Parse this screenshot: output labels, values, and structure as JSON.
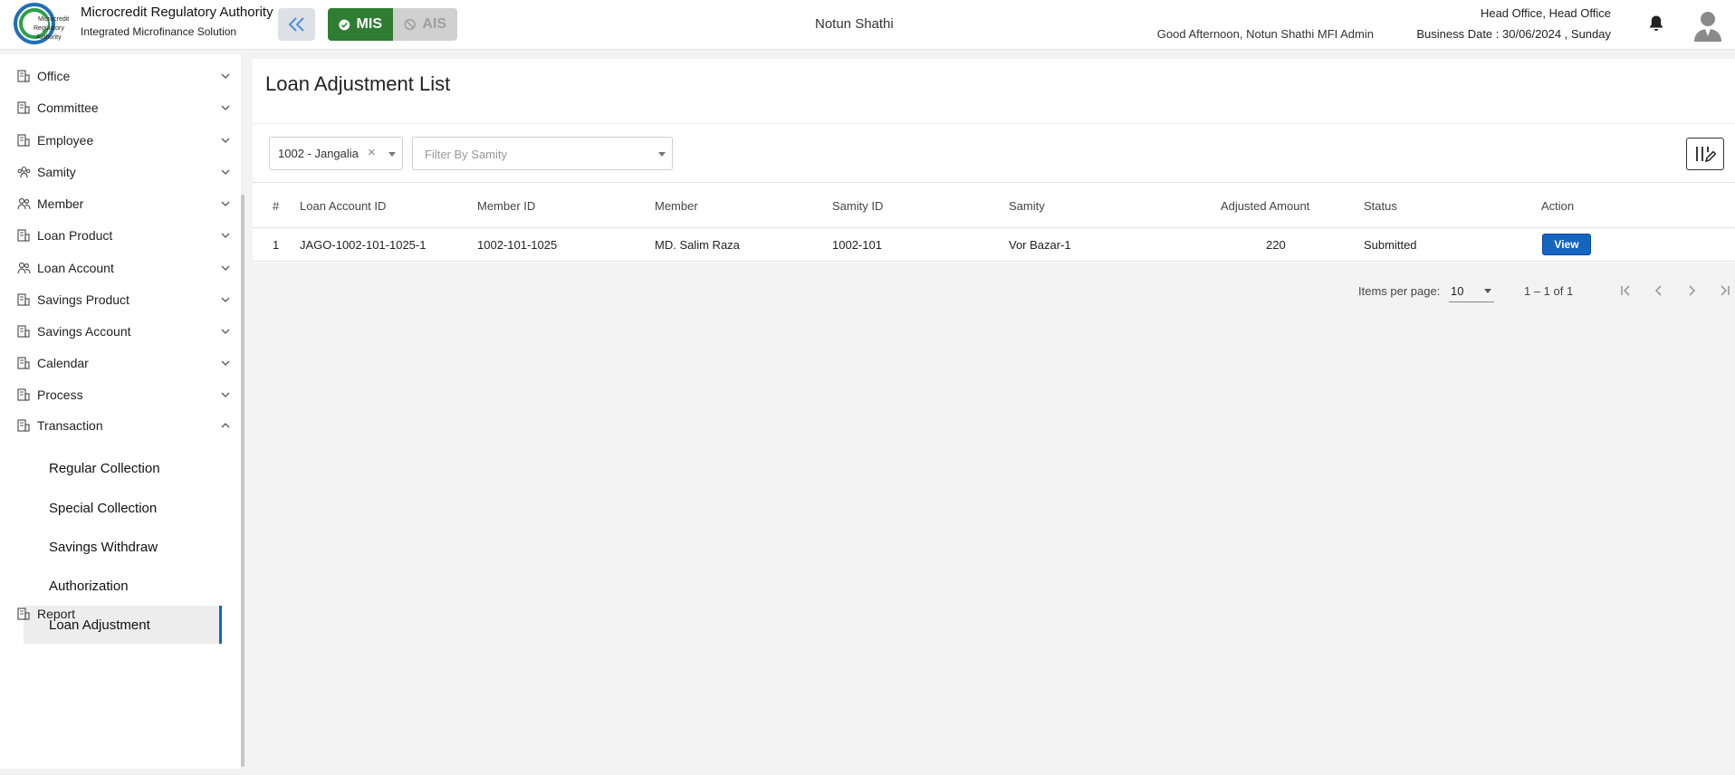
{
  "header": {
    "brand_title": "Microcredit Regulatory Authority",
    "brand_subtitle": "Integrated Microfinance Solution",
    "logo_text": [
      "Microcredit",
      "Regulatory",
      "Authority"
    ],
    "mode_mis": "MIS",
    "mode_ais": "AIS",
    "org_name": "Notun Shathi",
    "greeting": "Good Afternoon, Notun Shathi MFI Admin",
    "office": "Head Office, Head Office",
    "business_date": "Business Date : 30/06/2024 , Sunday"
  },
  "sidebar": {
    "items": [
      {
        "label": "Office",
        "icon": "building-icon"
      },
      {
        "label": "Committee",
        "icon": "building-icon"
      },
      {
        "label": "Employee",
        "icon": "building-icon"
      },
      {
        "label": "Samity",
        "icon": "group-icon"
      },
      {
        "label": "Member",
        "icon": "users-icon"
      },
      {
        "label": "Loan Product",
        "icon": "building-icon"
      },
      {
        "label": "Loan Account",
        "icon": "users-icon"
      },
      {
        "label": "Savings Product",
        "icon": "building-icon"
      },
      {
        "label": "Savings Account",
        "icon": "building-icon"
      },
      {
        "label": "Calendar",
        "icon": "building-icon"
      },
      {
        "label": "Process",
        "icon": "building-icon"
      },
      {
        "label": "Transaction",
        "icon": "building-icon"
      }
    ],
    "sub_items": [
      {
        "label": "Regular Collection"
      },
      {
        "label": "Special Collection"
      },
      {
        "label": "Savings Withdraw"
      },
      {
        "label": "Authorization"
      },
      {
        "label": "Loan Adjustment"
      }
    ],
    "report_label": "Report"
  },
  "main": {
    "title": "Loan Adjustment List",
    "office_filter_value": "1002 - Jangalia",
    "samity_filter_placeholder": "Filter By Samity",
    "columns": [
      "#",
      "Loan Account ID",
      "Member ID",
      "Member",
      "Samity ID",
      "Samity",
      "Adjusted Amount",
      "Status",
      "Action"
    ],
    "rows": [
      {
        "no": "1",
        "loan_account_id": "JAGO-1002-101-1025-1",
        "member_id": "1002-101-1025",
        "member": "MD. Salim Raza",
        "samity_id": "1002-101",
        "samity": "Vor Bazar-1",
        "adjusted_amount": "220",
        "status": "Submitted",
        "action": "View"
      }
    ],
    "paginator": {
      "items_per_page_label": "Items per page:",
      "page_size": "10",
      "range": "1 – 1 of 1"
    }
  },
  "colors": {
    "mis_green": "#2e7d32",
    "primary_blue": "#1565c0",
    "ais_disabled": "#d0d0d0"
  }
}
